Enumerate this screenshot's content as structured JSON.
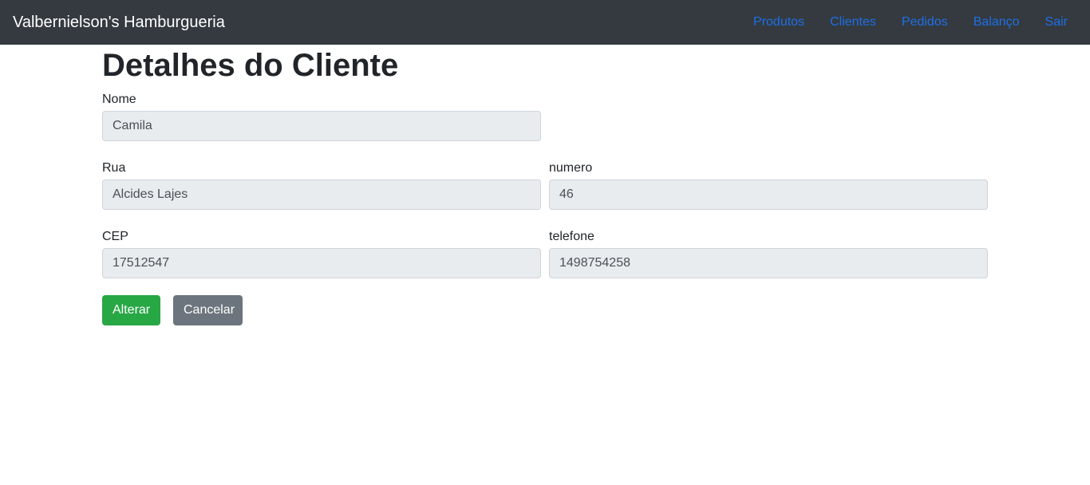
{
  "navbar": {
    "brand": "Valbernielson's Hamburgueria",
    "links": [
      "Produtos",
      "Clientes",
      "Pedidos",
      "Balanço",
      "Sair"
    ],
    "link_color": "#1f6fe5",
    "background": "#343a40"
  },
  "page": {
    "title": "Detalhes do Cliente"
  },
  "form": {
    "nome": {
      "label": "Nome",
      "value": "Camila"
    },
    "rua": {
      "label": "Rua",
      "value": "Alcides Lajes"
    },
    "numero": {
      "label": "numero",
      "value": "46"
    },
    "cep": {
      "label": "CEP",
      "value": "17512547"
    },
    "telefone": {
      "label": "telefone",
      "value": "1498754258"
    }
  },
  "actions": {
    "alterar_label": "Alterar",
    "cancelar_label": "Cancelar",
    "alterar_color": "#28a745",
    "cancelar_color": "#6c757d"
  }
}
